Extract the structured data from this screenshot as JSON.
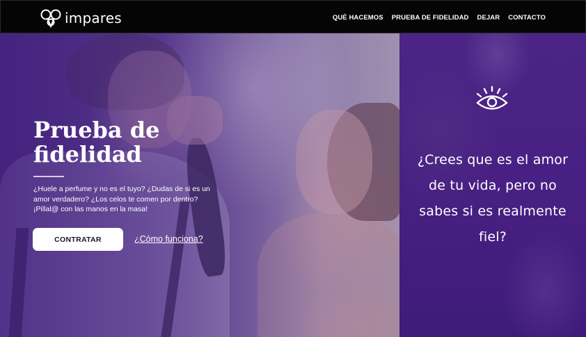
{
  "brand": {
    "name": "impares"
  },
  "nav": {
    "items": [
      {
        "label": "QUÉ HACEMOS"
      },
      {
        "label": "PRUEBA DE FIDELIDAD"
      },
      {
        "label": "DEJAR"
      },
      {
        "label": "CONTACTO"
      }
    ]
  },
  "hero": {
    "title": "Prueba de fidelidad",
    "description": "¿Huele a perfume y no es el tuyo? ¿Dudas de si es un amor verdadero? ¿Los celos te comen por dentro? ¡Pillal@ con las manos en la masa!",
    "primary_button": "CONTRATAR",
    "secondary_link": "¿Cómo funciona?"
  },
  "side_panel": {
    "icon": "eye-icon",
    "text": "¿Crees que es el amor de tu vida, pero no sabes si es realmente fiel?"
  },
  "colors": {
    "navbar": "#050505",
    "panel_purple": "#482083",
    "overlay_purple": "#4a2382",
    "button_bg": "#ffffff"
  }
}
